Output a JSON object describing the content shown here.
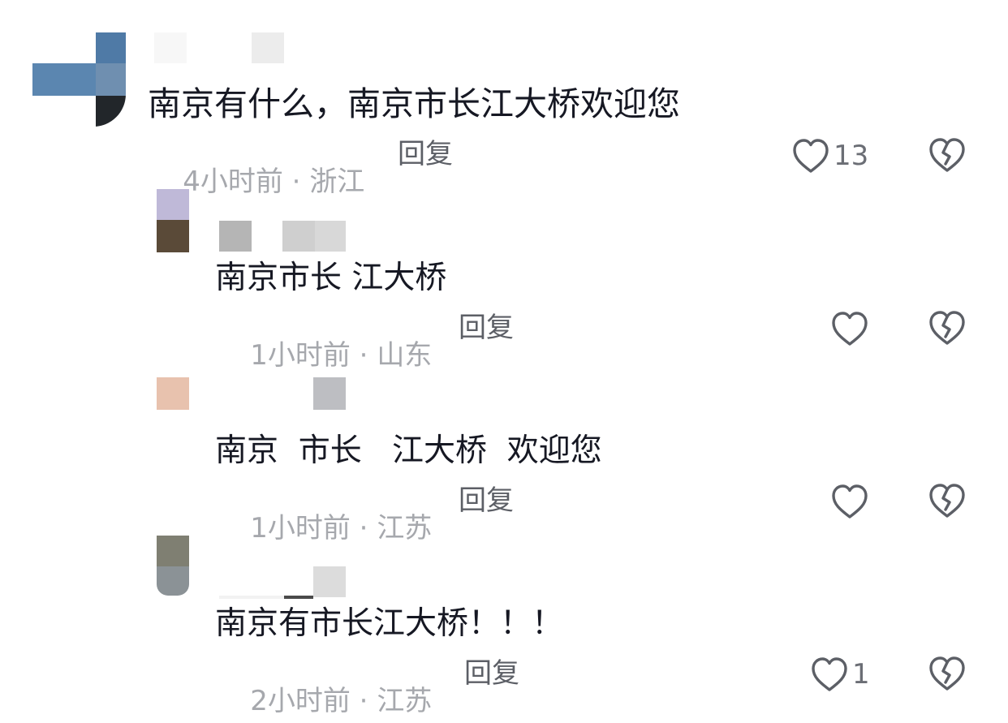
{
  "comments": [
    {
      "text": "南京有什么，南京市长江大桥欢迎您",
      "time": "4小时前",
      "location": "浙江",
      "separator": " · ",
      "reply_label": "回复",
      "likes": "13"
    },
    {
      "text": "南京市长 江大桥",
      "time": "1小时前",
      "location": "山东",
      "separator": " · ",
      "reply_label": "回复",
      "likes": ""
    },
    {
      "text": "南京  市长   江大桥  欢迎您",
      "time": "1小时前",
      "location": "江苏",
      "separator": " · ",
      "reply_label": "回复",
      "likes": ""
    },
    {
      "text": "南京有市长江大桥！！！",
      "time": "2小时前",
      "location": "江苏",
      "separator": " · ",
      "reply_label": "回复",
      "likes": "1"
    }
  ],
  "icons": {
    "like": "heart-outline-icon",
    "dislike": "broken-heart-icon"
  },
  "colors": {
    "text": "#161823",
    "meta": "#a6a8ad",
    "reply": "#5c5f66",
    "icon": "#5c5f66"
  }
}
